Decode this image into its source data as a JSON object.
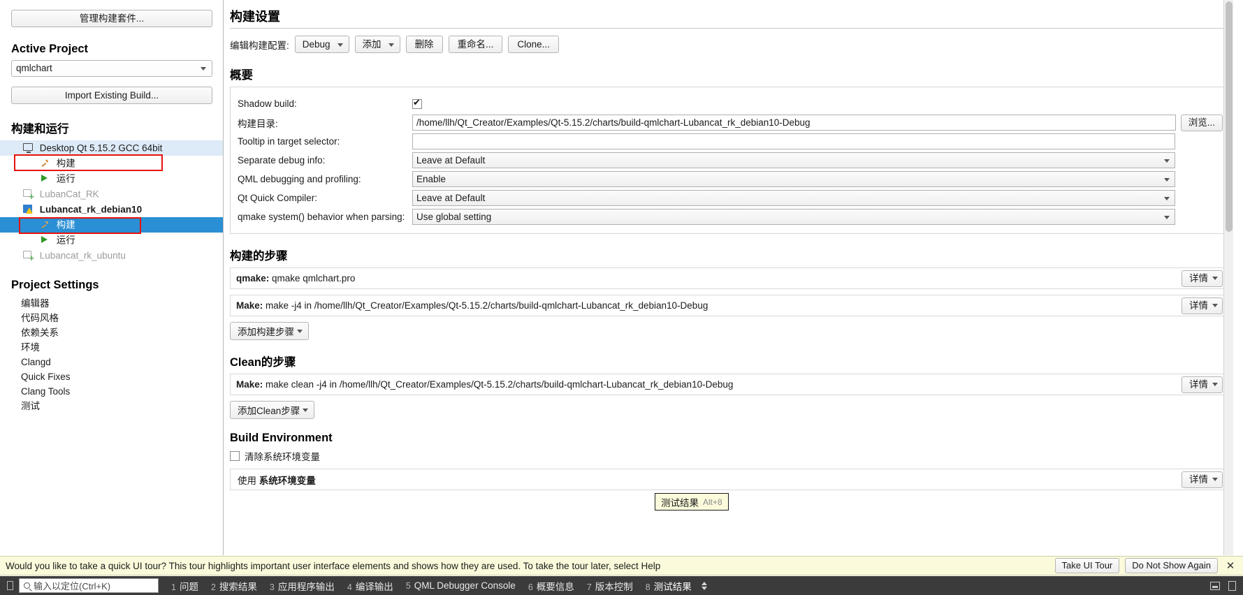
{
  "sidebar": {
    "manage_kits_button": "管理构建套件...",
    "active_project_heading": "Active Project",
    "active_project_value": "qmlchart",
    "import_existing_build_button": "Import Existing Build...",
    "build_and_run_heading": "构建和运行",
    "tree": [
      {
        "label": "Desktop Qt 5.15.2 GCC 64bit",
        "icon": "monitor-icon",
        "level": "kit",
        "state": "selected-light",
        "highlight": true
      },
      {
        "label": "构建",
        "icon": "hammer-icon",
        "level": "child",
        "state": "normal",
        "highlight": false
      },
      {
        "label": "运行",
        "icon": "play-icon",
        "level": "child",
        "state": "normal",
        "highlight": false
      },
      {
        "label": "LubanCat_RK",
        "icon": "device-add-icon",
        "level": "kit",
        "state": "disabled",
        "highlight": false
      },
      {
        "label": "Lubancat_rk_debian10",
        "icon": "device-warning-icon",
        "level": "kit",
        "state": "bold",
        "highlight": true
      },
      {
        "label": "构建",
        "icon": "hammer-icon",
        "level": "child",
        "state": "selected-blue",
        "highlight": false
      },
      {
        "label": "运行",
        "icon": "play-icon",
        "level": "child",
        "state": "normal",
        "highlight": false
      },
      {
        "label": "Lubancat_rk_ubuntu",
        "icon": "device-add-icon",
        "level": "kit",
        "state": "disabled",
        "highlight": false
      }
    ],
    "project_settings_heading": "Project Settings",
    "project_settings_items": [
      "编辑器",
      "代码风格",
      "依赖关系",
      "环境",
      "Clangd",
      "Quick Fixes",
      "Clang Tools",
      "测试"
    ]
  },
  "main": {
    "page_title": "构建设置",
    "toolbar": {
      "edit_build_config_label": "编辑构建配置:",
      "config_value": "Debug",
      "add_button": "添加",
      "remove_button": "删除",
      "rename_button": "重命名...",
      "clone_button": "Clone..."
    },
    "summary": {
      "heading": "概要",
      "shadow_build_label": "Shadow build:",
      "shadow_build_checked": true,
      "build_dir_label": "构建目录:",
      "build_dir_value": "/home/llh/Qt_Creator/Examples/Qt-5.15.2/charts/build-qmlchart-Lubancat_rk_debian10-Debug",
      "browse_button": "浏览...",
      "tooltip_label": "Tooltip in target selector:",
      "tooltip_value": "",
      "separate_debug_label": "Separate debug info:",
      "separate_debug_value": "Leave at Default",
      "qml_debug_label": "QML debugging and profiling:",
      "qml_debug_value": "Enable",
      "qt_quick_compiler_label": "Qt Quick Compiler:",
      "qt_quick_compiler_value": "Leave at Default",
      "qmake_system_label": "qmake system() behavior when parsing:",
      "qmake_system_value": "Use global setting"
    },
    "build_steps": {
      "heading": "构建的步骤",
      "steps": [
        {
          "prefix": "qmake:",
          "text": " qmake qmlchart.pro",
          "detail_button": "详情"
        },
        {
          "prefix": "Make:",
          "text": " make -j4 in /home/llh/Qt_Creator/Examples/Qt-5.15.2/charts/build-qmlchart-Lubancat_rk_debian10-Debug",
          "detail_button": "详情"
        }
      ],
      "add_button": "添加构建步骤"
    },
    "clean_steps": {
      "heading": "Clean的步骤",
      "steps": [
        {
          "prefix": "Make:",
          "text": " make clean -j4 in /home/llh/Qt_Creator/Examples/Qt-5.15.2/charts/build-qmlchart-Lubancat_rk_debian10-Debug",
          "detail_button": "详情"
        }
      ],
      "add_button": "添加Clean步骤"
    },
    "build_environment": {
      "heading": "Build Environment",
      "clear_system_env_label": "清除系统环境变量",
      "clear_system_env_checked": false,
      "use_prefix": "使用 ",
      "use_value": "系统环境变量",
      "detail_button": "详情"
    }
  },
  "infobar": {
    "message": "Would you like to take a quick UI tour? This tour highlights important user interface elements and shows how they are used. To take the tour later, select Help",
    "take_tour_button": "Take UI Tour",
    "do_not_show_button": "Do Not Show Again",
    "close_icon": "✕"
  },
  "tooltip": {
    "label": "测试结果",
    "shortcut": "Alt+8"
  },
  "statusbar": {
    "locator_placeholder": "输入以定位(Ctrl+K)",
    "outputs": [
      {
        "num": "1",
        "label": "问题"
      },
      {
        "num": "2",
        "label": "搜索结果"
      },
      {
        "num": "3",
        "label": "应用程序输出"
      },
      {
        "num": "4",
        "label": "编译输出"
      },
      {
        "num": "5",
        "label": "QML Debugger Console"
      },
      {
        "num": "6",
        "label": "概要信息"
      },
      {
        "num": "7",
        "label": "版本控制"
      },
      {
        "num": "8",
        "label": "测试结果"
      }
    ]
  },
  "colors": {
    "selection_blue": "#2a8fd4",
    "selection_light": "#ddeaf7",
    "highlight_red": "#e8120b",
    "infobar_yellow": "#fbfbdc",
    "statusbar_dark": "#3b3b3b"
  }
}
